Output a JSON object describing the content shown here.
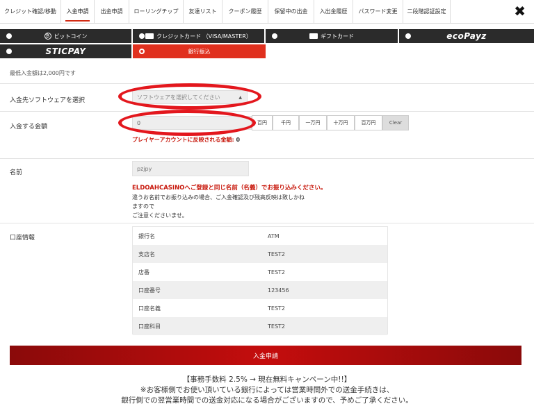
{
  "tabs": [
    {
      "label": "クレジット確認/移動",
      "active": false
    },
    {
      "label": "入金申請",
      "active": true
    },
    {
      "label": "出金申請",
      "active": false
    },
    {
      "label": "ローリングチップ",
      "active": false
    },
    {
      "label": "友達リスト",
      "active": false
    },
    {
      "label": "クーポン履歴",
      "active": false
    },
    {
      "label": "保留中の出金",
      "active": false
    },
    {
      "label": "入出金履歴",
      "active": false
    },
    {
      "label": "パスワード変更",
      "active": false
    },
    {
      "label": "二段階認証設定",
      "active": false
    }
  ],
  "close_symbol": "✖",
  "methods": {
    "bitcoin": "ビットコイン",
    "credit_card": "クレジットカード （VISA/MASTER）",
    "gift_card": "ギフトカード",
    "ecopayz": "ecoPayz",
    "sticpay": "STICPAY",
    "bank_transfer": "銀行振込",
    "selected": "bank_transfer"
  },
  "min_deposit_note": "最低入金額は2,000円です",
  "software": {
    "label": "入金先ソフトウェアを選択",
    "placeholder": "ソフトウェアを選択してください"
  },
  "amount": {
    "label": "入金する金額",
    "value": "0",
    "quick_buttons": [
      "百円",
      "千円",
      "一万円",
      "十万円",
      "百万円",
      "Clear"
    ],
    "preview_prefix": "プレイヤーアカウントに反映される金額:",
    "preview_value": "0"
  },
  "name": {
    "label": "名前",
    "value": "pzjpy",
    "warning": "ELDOAHCASINOへご登録と同じ名前（名義）でお振り込みください。",
    "note_line1": "違うお名前でお振り込みの場合、ご入金確認及び残高反映は致しかね",
    "note_line2": "ますので",
    "note_line3": "ご注意くださいませ。"
  },
  "bank": {
    "label": "口座情報",
    "rows": [
      {
        "key": "銀行名",
        "value": "ATM"
      },
      {
        "key": "支店名",
        "value": "TEST2"
      },
      {
        "key": "店番",
        "value": "TEST2"
      },
      {
        "key": "口座番号",
        "value": "123456"
      },
      {
        "key": "口座名義",
        "value": "TEST2"
      },
      {
        "key": "口座科目",
        "value": "TEST2"
      }
    ]
  },
  "submit_label": "入金申請",
  "footer": {
    "line1": "【事務手数料 2.5% → 現在無料キャンペーン中!!】",
    "line2": "※お客様側でお使い頂いている銀行によっては営業時間外での送金手続きは、",
    "line3": "銀行側での翌営業時間での送金対応になる場合がございますので、予めご了承ください。"
  },
  "colors": {
    "accent": "#e0301e",
    "dark": "#2b2b2b",
    "warning": "#c8180c"
  }
}
